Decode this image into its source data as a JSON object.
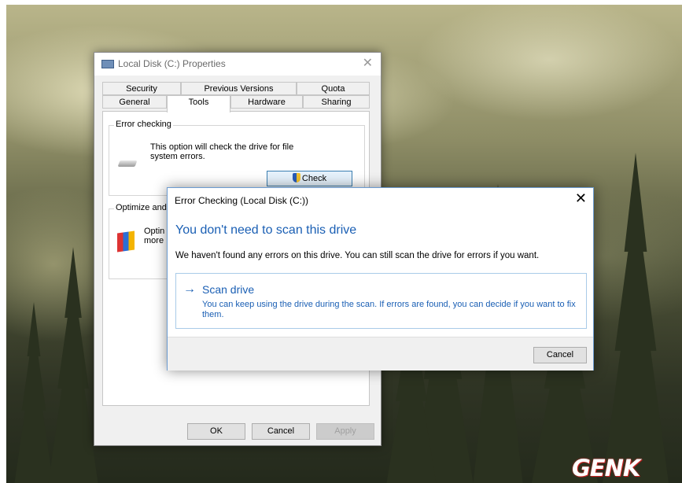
{
  "props_window": {
    "title": "Local Disk (C:) Properties",
    "close_glyph": "✕",
    "tabs_row1": [
      "Security",
      "Previous Versions",
      "Quota"
    ],
    "tabs_row2": [
      "General",
      "Tools",
      "Hardware",
      "Sharing"
    ],
    "active_tab": "Tools",
    "error_checking": {
      "label": "Error checking",
      "description": "This option will check the drive for file system errors.",
      "check_button": "Check"
    },
    "optimize": {
      "label": "Optimize and",
      "text_line1": "Optin",
      "text_line2": "more"
    },
    "buttons": {
      "ok": "OK",
      "cancel": "Cancel",
      "apply": "Apply"
    }
  },
  "dialog": {
    "title": "Error Checking (Local Disk (C:))",
    "close_glyph": "✕",
    "heading": "You don't need to scan this drive",
    "body": "We haven't found any errors on this drive. You can still scan the drive for errors if you want.",
    "scan_arrow": "→",
    "scan_title": "Scan drive",
    "scan_desc": "You can keep using the drive during the scan. If errors are found, you can decide if you want to fix them.",
    "cancel": "Cancel"
  },
  "watermark": "GENK",
  "colors": {
    "accent": "#1a5fb4",
    "dialog_border": "#6b9bd1"
  },
  "icons": [
    "drive-icon",
    "shield-icon",
    "optimize-icon",
    "close-icon",
    "arrow-right-icon"
  ]
}
